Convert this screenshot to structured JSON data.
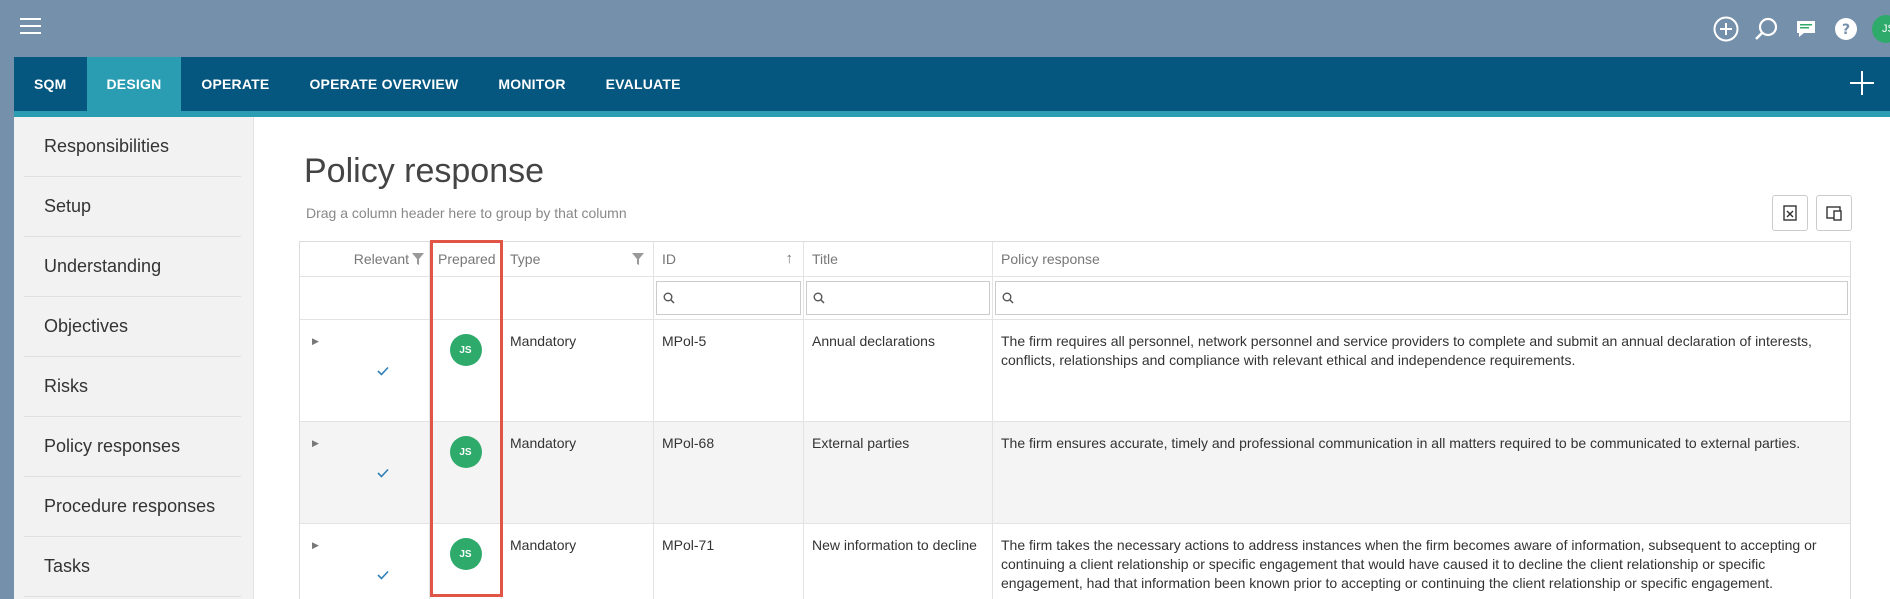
{
  "topbar": {
    "icons": [
      "add-circle-icon",
      "search-icon",
      "chat-icon",
      "help-icon"
    ],
    "user_initials": "JS"
  },
  "nav": {
    "items": [
      {
        "label": "SQM",
        "active": false
      },
      {
        "label": "DESIGN",
        "active": true
      },
      {
        "label": "OPERATE",
        "active": false
      },
      {
        "label": "OPERATE OVERVIEW",
        "active": false
      },
      {
        "label": "MONITOR",
        "active": false
      },
      {
        "label": "EVALUATE",
        "active": false
      }
    ]
  },
  "sidebar": {
    "items": [
      {
        "label": "Responsibilities"
      },
      {
        "label": "Setup"
      },
      {
        "label": "Understanding"
      },
      {
        "label": "Objectives"
      },
      {
        "label": "Risks"
      },
      {
        "label": "Policy responses"
      },
      {
        "label": "Procedure responses"
      },
      {
        "label": "Tasks"
      }
    ]
  },
  "main": {
    "title": "Policy response",
    "group_hint": "Drag a column header here to group by that column"
  },
  "grid": {
    "columns": [
      "Relevant",
      "Prepared",
      "Type",
      "ID",
      "Title",
      "Policy response"
    ],
    "rows": [
      {
        "relevant": true,
        "prepared": "JS",
        "type": "Mandatory",
        "id": "MPol-5",
        "title": "Annual declarations",
        "policy_response": "The firm requires all personnel, network personnel and service providers to complete and submit an annual declaration of interests, conflicts, relationships and compliance with relevant ethical and independence requirements."
      },
      {
        "relevant": true,
        "prepared": "JS",
        "type": "Mandatory",
        "id": "MPol-68",
        "title": "External parties",
        "policy_response": "The firm ensures accurate, timely and professional communication in all matters required to be communicated to external parties."
      },
      {
        "relevant": true,
        "prepared": "JS",
        "type": "Mandatory",
        "id": "MPol-71",
        "title": "New information to decline",
        "policy_response": "The firm takes the necessary actions to address instances when the firm becomes aware of information, subsequent to accepting or continuing a client relationship or specific engagement that would have caused it to decline the client relationship or specific engagement, had that information been known prior to accepting or continuing the client relationship or specific engagement."
      }
    ]
  },
  "colors": {
    "topbar": "#7590ab",
    "navbar": "#06577f",
    "nav_active": "#2a9db3",
    "avatar": "#2eaa6b",
    "highlight": "#e05545"
  }
}
